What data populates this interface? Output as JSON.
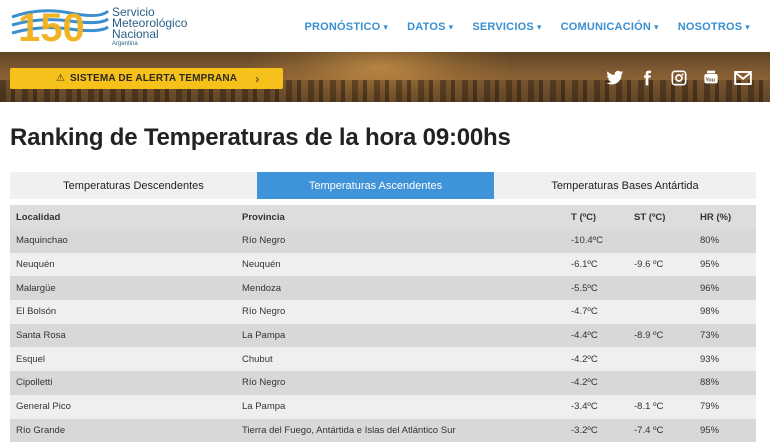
{
  "header": {
    "logo_number": "150",
    "logo_line1": "Servicio",
    "logo_line2": "Meteorológico",
    "logo_line3": "Nacional",
    "logo_line4": "Argentina",
    "nav": [
      {
        "label": "PRONÓSTICO"
      },
      {
        "label": "DATOS"
      },
      {
        "label": "SERVICIOS"
      },
      {
        "label": "COMUNICACIÓN"
      },
      {
        "label": "NOSOTROS"
      }
    ]
  },
  "banner": {
    "alert_label": "SISTEMA DE ALERTA TEMPRANA",
    "social": [
      "twitter-icon",
      "facebook-icon",
      "instagram-icon",
      "youtube-icon",
      "mail-icon"
    ]
  },
  "page": {
    "title": "Ranking de Temperaturas de la hora 09:00hs"
  },
  "tabs": [
    {
      "label": "Temperaturas Descendentes",
      "active": false
    },
    {
      "label": "Temperaturas Ascendentes",
      "active": true
    },
    {
      "label": "Temperaturas Bases Antártida",
      "active": false
    }
  ],
  "table": {
    "columns": [
      "Localidad",
      "Provincia",
      "T (ºC)",
      "ST (ºC)",
      "HR (%)"
    ],
    "rows": [
      [
        "Maquinchao",
        "Río Negro",
        "-10.4ºC",
        "",
        "80%"
      ],
      [
        "Neuquén",
        "Neuquén",
        "-6.1ºC",
        "-9.6 ºC",
        "95%"
      ],
      [
        "Malargüe",
        "Mendoza",
        "-5.5ºC",
        "",
        "96%"
      ],
      [
        "El Bolsón",
        "Río Negro",
        "-4.7ºC",
        "",
        "98%"
      ],
      [
        "Santa Rosa",
        "La Pampa",
        "-4.4ºC",
        "-8.9 ºC",
        "73%"
      ],
      [
        "Esquel",
        "Chubut",
        "-4.2ºC",
        "",
        "93%"
      ],
      [
        "Cipolletti",
        "Río Negro",
        "-4.2ºC",
        "",
        "88%"
      ],
      [
        "General Pico",
        "La Pampa",
        "-3.4ºC",
        "-8.1 ºC",
        "79%"
      ],
      [
        "Río Grande",
        "Tierra del Fuego, Antártida e Islas del Atlántico Sur",
        "-3.2ºC",
        "-7.4 ºC",
        "95%"
      ]
    ]
  },
  "colors": {
    "nav_blue": "#3a8fcf",
    "active_tab": "#3f93d8",
    "alert_yellow": "#f6c11a"
  }
}
